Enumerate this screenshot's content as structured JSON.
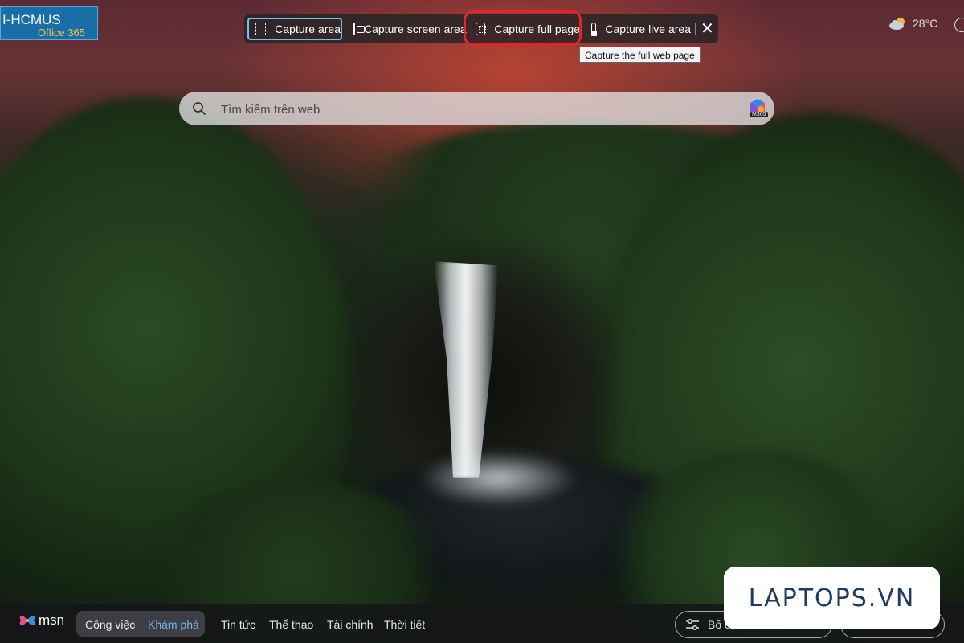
{
  "org_tag": {
    "name": "I-HCMUS",
    "sub": "Office 365"
  },
  "capture_toolbar": {
    "buttons": [
      {
        "label": "Capture area",
        "icon": "dashed-rectangle-icon"
      },
      {
        "label": "Capture screen area",
        "icon": "screen-area-icon"
      },
      {
        "label": "Capture full page",
        "icon": "full-page-icon"
      },
      {
        "label": "Capture live area",
        "icon": "live-area-icon"
      }
    ],
    "close_icon": "close-icon",
    "tooltip": "Capture the full web page",
    "highlight_color": "#e0262b"
  },
  "weather": {
    "temp": "28°C",
    "icon": "partly-cloudy-icon"
  },
  "search": {
    "placeholder": "Tìm kiếm trên web",
    "badge": "M365"
  },
  "bottom_nav": {
    "brand": "msn",
    "items": [
      "Công việc",
      "Khám phá",
      "Tin tức",
      "Thể thao",
      "Tài chính",
      "Thời tiết"
    ],
    "selected": "Khám phá",
    "filter_label": "Bố cục"
  },
  "watermark": {
    "text": "LAPTOPS.VN"
  },
  "colors": {
    "accent": "#6fc3ea",
    "nav_selected": "#6fb6f0",
    "watermark_text": "#1f3b63"
  }
}
